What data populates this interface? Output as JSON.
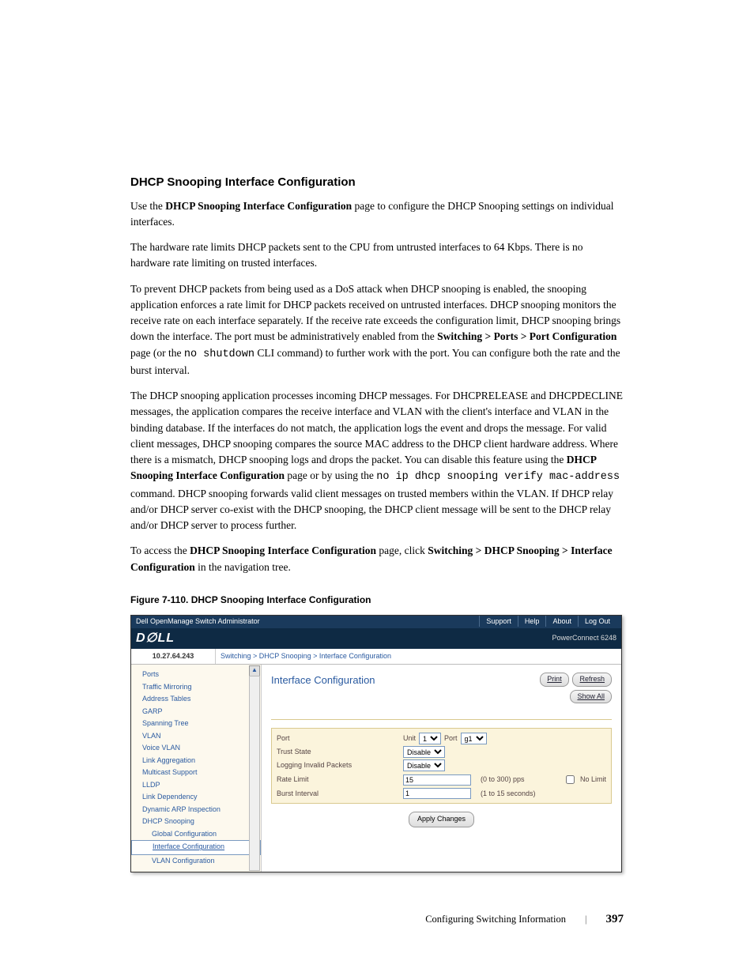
{
  "heading": "DHCP Snooping Interface Configuration",
  "p1a": "Use the ",
  "p1b": "DHCP Snooping Interface Configuration",
  "p1c": " page to configure the DHCP Snooping settings on individual interfaces.",
  "p2": "The hardware rate limits DHCP packets sent to the CPU from untrusted interfaces to 64 Kbps. There is no hardware rate limiting on trusted interfaces.",
  "p3a": "To prevent DHCP packets from being used as a DoS attack when DHCP snooping is enabled, the snooping application enforces a rate limit for DHCP packets received on untrusted interfaces. DHCP snooping monitors the receive rate on each interface separately. If the receive rate exceeds the configuration limit, DHCP snooping brings down the interface. The port must be administratively enabled from the ",
  "p3b": "Switching > Ports > Port Configuration",
  "p3c": " page (or the ",
  "p3d": "no shutdown",
  "p3e": " CLI command) to further work with the port. You can configure both the rate and the burst interval.",
  "p4a": "The DHCP snooping application processes incoming DHCP messages. For DHCPRELEASE and DHCPDECLINE messages, the application compares the receive interface and VLAN with the client's interface and VLAN in the binding database. If the interfaces do not match, the application logs the event and drops the message. For valid client messages, DHCP snooping compares the source MAC address to the DHCP client hardware address. Where there is a mismatch, DHCP snooping logs and drops the packet. You can disable this feature using the ",
  "p4b": "DHCP Snooping Interface Configuration",
  "p4c": " page or by using the ",
  "p4d": "no ip dhcp snooping verify mac-address",
  "p4e": " command. DHCP snooping forwards valid client messages on trusted members within the VLAN. If DHCP relay and/or DHCP server co-exist with the DHCP snooping, the DHCP client message will be sent to the DHCP relay and/or DHCP server to process further.",
  "p5a": "To access the ",
  "p5b": "DHCP Snooping Interface Configuration",
  "p5c": " page, click ",
  "p5d": "Switching > DHCP Snooping > Interface Configuration",
  "p5e": " in the navigation tree.",
  "figcap": "Figure 7-110.    DHCP Snooping Interface Configuration",
  "shot": {
    "title": "Dell OpenManage Switch Administrator",
    "links": {
      "support": "Support",
      "help": "Help",
      "about": "About",
      "logout": "Log Out"
    },
    "model": "PowerConnect 6248",
    "ip": "10.27.64.243",
    "crumbs": "Switching > DHCP Snooping > Interface Configuration",
    "nav": {
      "ports": "Ports",
      "traffic": "Traffic Mirroring",
      "addr": "Address Tables",
      "garp": "GARP",
      "span": "Spanning Tree",
      "vlan": "VLAN",
      "voice": "Voice VLAN",
      "lag": "Link Aggregation",
      "mcast": "Multicast Support",
      "lldp": "LLDP",
      "linkdep": "Link Dependency",
      "dai": "Dynamic ARP Inspection",
      "dhcp": "DHCP Snooping",
      "global": "Global Configuration",
      "ifc": "Interface Configuration",
      "vlanc": "VLAN Configuration"
    },
    "panel": {
      "title": "Interface Configuration",
      "print": "Print",
      "refresh": "Refresh",
      "showall": "Show All",
      "rows": {
        "port_l": "Port",
        "unit_l": "Unit",
        "unit_v": "1",
        "port2_l": "Port",
        "port_v": "g1",
        "trust_l": "Trust State",
        "trust_v": "Disable",
        "log_l": "Logging Invalid Packets",
        "log_v": "Disable",
        "rate_l": "Rate Limit",
        "rate_v": "15",
        "rate_h": "(0 to 300) pps",
        "nolimit": "No Limit",
        "burst_l": "Burst Interval",
        "burst_v": "1",
        "burst_h": "(1 to 15 seconds)"
      },
      "apply": "Apply Changes"
    }
  },
  "footer": {
    "section": "Configuring Switching Information",
    "page": "397"
  }
}
